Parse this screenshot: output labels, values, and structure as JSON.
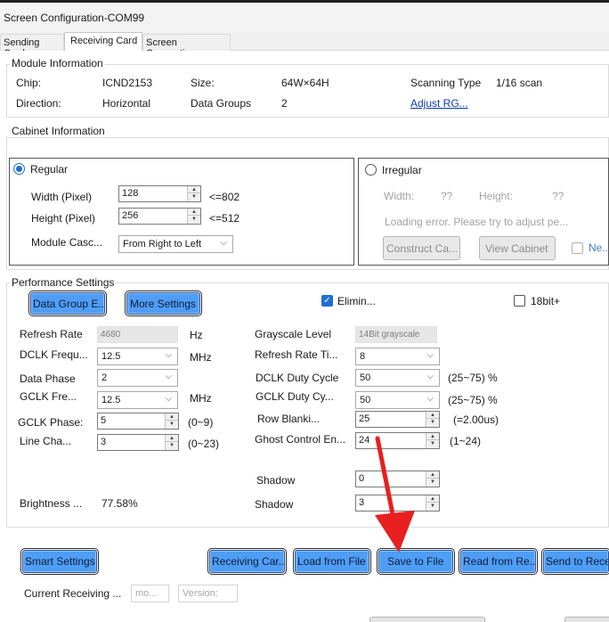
{
  "window": {
    "title": "Screen Configuration-COM99"
  },
  "tabs": [
    {
      "label": "Sending Card"
    },
    {
      "label": "Receiving Card"
    },
    {
      "label": "Screen Connection"
    }
  ],
  "module_info": {
    "legend": "Module Information",
    "chip_label": "Chip:",
    "chip_value": "ICND2153",
    "size_label": "Size:",
    "size_value": "64W×64H",
    "scanning_label": "Scanning Type",
    "scanning_value": "1/16 scan",
    "direction_label": "Direction:",
    "direction_value": "Horizontal",
    "data_groups_label": "Data Groups",
    "data_groups_value": "2",
    "adjust_link": "Adjust RG..."
  },
  "cabinet_info": {
    "legend": "Cabinet Information",
    "regular_label": "Regular",
    "width_label": "Width (Pixel)",
    "width_value": "128",
    "width_limit": "<=802",
    "height_label": "Height (Pixel)",
    "height_value": "256",
    "height_limit": "<=512",
    "cascade_label": "Module Casc...",
    "cascade_value": "From Right to Left",
    "irregular_label": "Irregular",
    "irr_width_label": "Width:",
    "irr_width_value": "??",
    "irr_height_label": "Height:",
    "irr_height_value": "??",
    "loading_error": "Loading error. Please try to adjust pe...",
    "construct_btn": "Construct Ca...",
    "view_btn": "View Cabinet",
    "ne_label": "Ne..."
  },
  "performance": {
    "legend": "Performance Settings",
    "data_group_btn": "Data Group E...",
    "more_settings_btn": "More Settings",
    "elimin_label": "Elimin...",
    "bit18_label": "18bit+",
    "refresh_rate_label": "Refresh Rate",
    "refresh_rate_value": "4680",
    "refresh_rate_unit": "Hz",
    "dclk_freq_label": "DCLK Frequ...",
    "dclk_freq_value": "12.5",
    "dclk_freq_unit": "MHz",
    "data_phase_label": "Data Phase",
    "data_phase_value": "2",
    "gclk_freq_label": "GCLK Fre...",
    "gclk_freq_value": "12.5",
    "gclk_freq_unit": "MHz",
    "gclk_phase_label": "GCLK Phase:",
    "gclk_phase_value": "5",
    "gclk_phase_range": "(0~9)",
    "line_cha_label": "Line Cha...",
    "line_cha_value": "3",
    "line_cha_range": "(0~23)",
    "grayscale_label": "Grayscale Level",
    "grayscale_value": "14Bit grayscale",
    "refresh_rate_ti_label": "Refresh Rate Ti...",
    "refresh_rate_ti_value": "8",
    "dclk_duty_label": "DCLK Duty Cycle",
    "dclk_duty_value": "50",
    "dclk_duty_range": "(25~75) %",
    "gclk_duty_label": "GCLK Duty Cy...",
    "gclk_duty_value": "50",
    "gclk_duty_range": "(25~75) %",
    "row_blank_label": "Row Blanki...",
    "row_blank_value": "25",
    "row_blank_hint": "(=2.00us)",
    "ghost_label": "Ghost Control En...",
    "ghost_value": "24",
    "ghost_range": "(1~24)",
    "shadow1_label": "Shadow",
    "shadow1_value": "0",
    "shadow2_label": "Shadow",
    "shadow2_value": "3",
    "brightness_label": "Brightness ...",
    "brightness_value": "77.58%"
  },
  "footer": {
    "smart_settings_btn": "Smart Settings",
    "receiving_card_btn": "Receiving Car...",
    "load_from_file_btn": "Load from File",
    "save_to_file_btn": "Save to File",
    "read_from_btn": "Read from Re...",
    "send_to_btn": "Send to Rece",
    "current_receiving_label": "Current Receiving ...",
    "model_placeholder": "mo...",
    "version_placeholder": "Version:"
  },
  "colors": {
    "button_blue": "#4f9ef5",
    "arrow_red": "#e8201f",
    "link_blue": "#0a3aa8"
  }
}
